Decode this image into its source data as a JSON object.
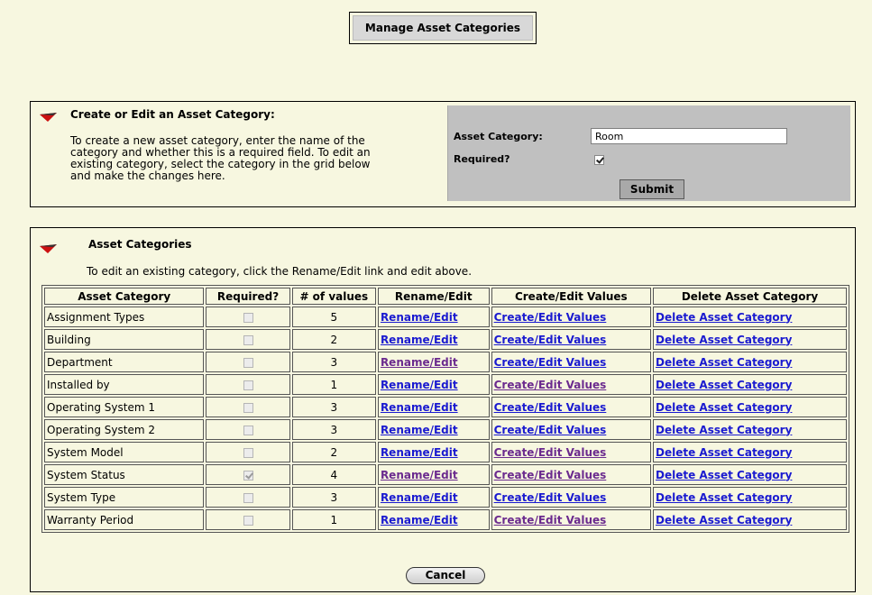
{
  "page_title": "Manage Asset Categories",
  "create": {
    "title": "Create or Edit an Asset Category:",
    "description": [
      "To create a new asset category, enter the name of the",
      "category and whether this is a required field. To edit an",
      "existing category, select the category in the grid below",
      "and make the changes here."
    ],
    "category_label": "Asset Category:",
    "category_value": "Room",
    "required_label": "Required?",
    "required_checked": true,
    "submit_label": "Submit"
  },
  "list": {
    "title": "Asset Categories",
    "instructions": "To edit an existing category, click the Rename/Edit link and edit above.",
    "columns": [
      "Asset Category",
      "Required?",
      "# of values",
      "Rename/Edit",
      "Create/Edit Values",
      "Delete Asset Category"
    ],
    "rows": [
      {
        "name": "Assignment Types",
        "required": false,
        "count": "5",
        "rename": "Rename/Edit",
        "values": "Create/Edit Values",
        "delete": "Delete Asset Category",
        "rename_visited": false,
        "values_visited": false
      },
      {
        "name": "Building",
        "required": false,
        "count": "2",
        "rename": "Rename/Edit",
        "values": "Create/Edit Values",
        "delete": "Delete Asset Category",
        "rename_visited": false,
        "values_visited": false
      },
      {
        "name": "Department",
        "required": false,
        "count": "3",
        "rename": "Rename/Edit",
        "values": "Create/Edit Values",
        "delete": "Delete Asset Category",
        "rename_visited": true,
        "values_visited": false
      },
      {
        "name": "Installed by",
        "required": false,
        "count": "1",
        "rename": "Rename/Edit",
        "values": "Create/Edit Values",
        "delete": "Delete Asset Category",
        "rename_visited": false,
        "values_visited": true
      },
      {
        "name": "Operating System 1",
        "required": false,
        "count": "3",
        "rename": "Rename/Edit",
        "values": "Create/Edit Values",
        "delete": "Delete Asset Category",
        "rename_visited": false,
        "values_visited": false
      },
      {
        "name": "Operating System 2",
        "required": false,
        "count": "3",
        "rename": "Rename/Edit",
        "values": "Create/Edit Values",
        "delete": "Delete Asset Category",
        "rename_visited": false,
        "values_visited": false
      },
      {
        "name": "System Model",
        "required": false,
        "count": "2",
        "rename": "Rename/Edit",
        "values": "Create/Edit Values",
        "delete": "Delete Asset Category",
        "rename_visited": false,
        "values_visited": true
      },
      {
        "name": "System Status",
        "required": true,
        "count": "4",
        "rename": "Rename/Edit",
        "values": "Create/Edit Values",
        "delete": "Delete Asset Category",
        "rename_visited": true,
        "values_visited": true
      },
      {
        "name": "System Type",
        "required": false,
        "count": "3",
        "rename": "Rename/Edit",
        "values": "Create/Edit Values",
        "delete": "Delete Asset Category",
        "rename_visited": false,
        "values_visited": false
      },
      {
        "name": "Warranty Period",
        "required": false,
        "count": "1",
        "rename": "Rename/Edit",
        "values": "Create/Edit Values",
        "delete": "Delete Asset Category",
        "rename_visited": false,
        "values_visited": true
      }
    ],
    "cancel_label": "Cancel"
  },
  "colors": {
    "background": "#f7f7e0",
    "link": "#1a1ad0",
    "link_visited": "#6b2a8e",
    "arrow_red": "#cc1111",
    "form_panel": "#c0c0c0"
  }
}
